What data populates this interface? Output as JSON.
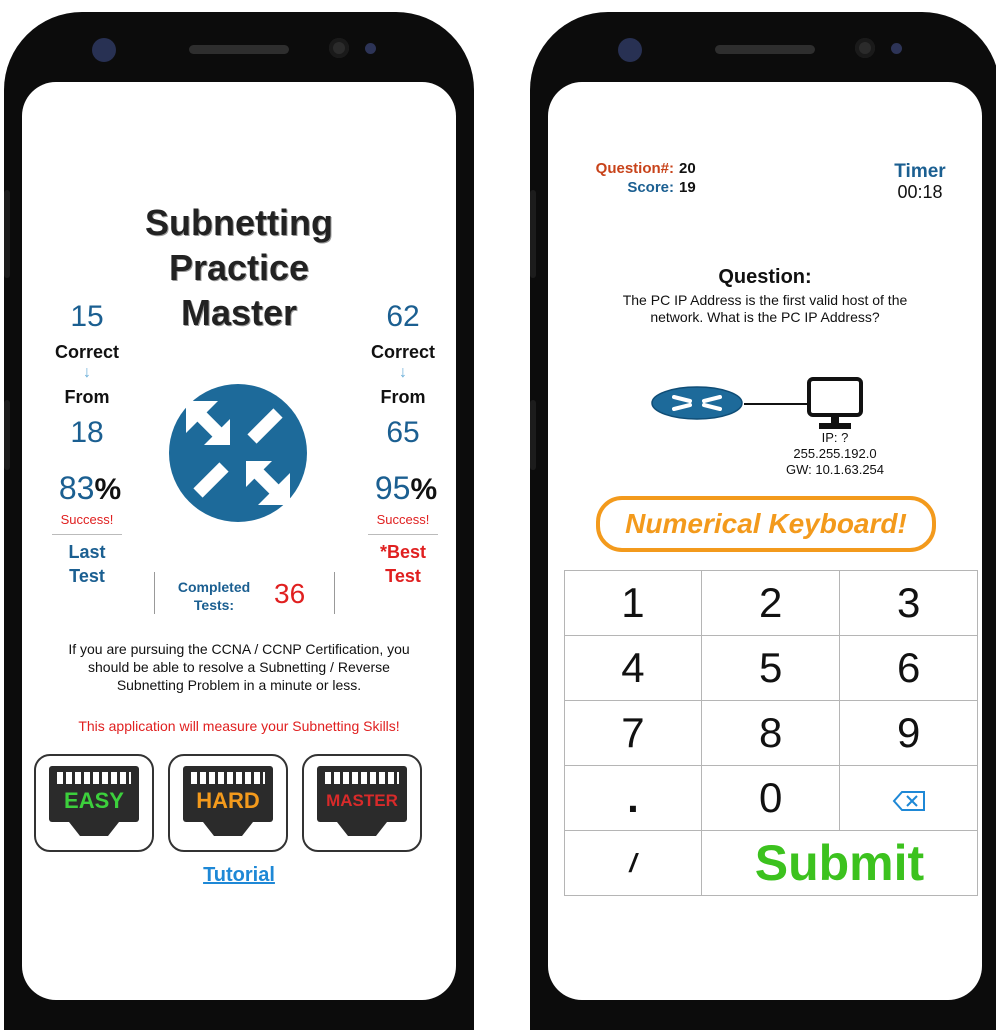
{
  "home": {
    "title_lines": [
      "Subnetting",
      "Practice",
      "Master"
    ],
    "last": {
      "correct": "15",
      "correct_label": "Correct",
      "arrow": "↓",
      "from_label": "From",
      "from": "18",
      "percent": "83",
      "percent_sign": "%",
      "success": "Success!",
      "label_lines": [
        "Last",
        "Test"
      ]
    },
    "best": {
      "correct": "62",
      "correct_label": "Correct",
      "arrow": "↓",
      "from_label": "From",
      "from": "65",
      "percent": "95",
      "percent_sign": "%",
      "success": "Success!",
      "star": "*",
      "label_lines": [
        "Best",
        "Test"
      ]
    },
    "completed_label_lines": [
      "Completed",
      "Tests:"
    ],
    "completed_value": "36",
    "info_lines": [
      "If you are pursuing the CCNA / CCNP Certification, you",
      "should be able to resolve a Subnetting / Reverse",
      "Subnetting Problem in a minute or less."
    ],
    "measure_text": "This application will measure your Subnetting Skills!",
    "levels": [
      {
        "label": "EASY",
        "color": "#3ccf3c"
      },
      {
        "label": "HARD",
        "color": "#f39a1c"
      },
      {
        "label": "MASTER",
        "color": "#d82a2a"
      }
    ],
    "tutorial": "Tutorial",
    "router_icon": "router-icon"
  },
  "quiz": {
    "question_num_label": "Question#:",
    "question_num": "20",
    "score_label": "Score:",
    "score": "19",
    "timer_label": "Timer",
    "timer": "00:18",
    "question_heading": "Question:",
    "question_lines": [
      "The PC IP Address is the first valid host of the",
      "network. What is the PC IP Address?"
    ],
    "pc_info_lines": [
      "IP: ?",
      "255.255.192.0",
      "GW: 10.1.63.254"
    ],
    "banner": "Numerical Keyboard!",
    "keys": [
      "1",
      "2",
      "3",
      "4",
      "5",
      "6",
      "7",
      "8",
      "9",
      ".",
      "0"
    ],
    "slash": "/",
    "submit": "Submit",
    "backspace_icon": "backspace-icon",
    "colors": {
      "orange_label": "#c8431a",
      "blue_label": "#1b5f91",
      "banner": "#f39a1c",
      "submit": "#3cc21e"
    }
  }
}
